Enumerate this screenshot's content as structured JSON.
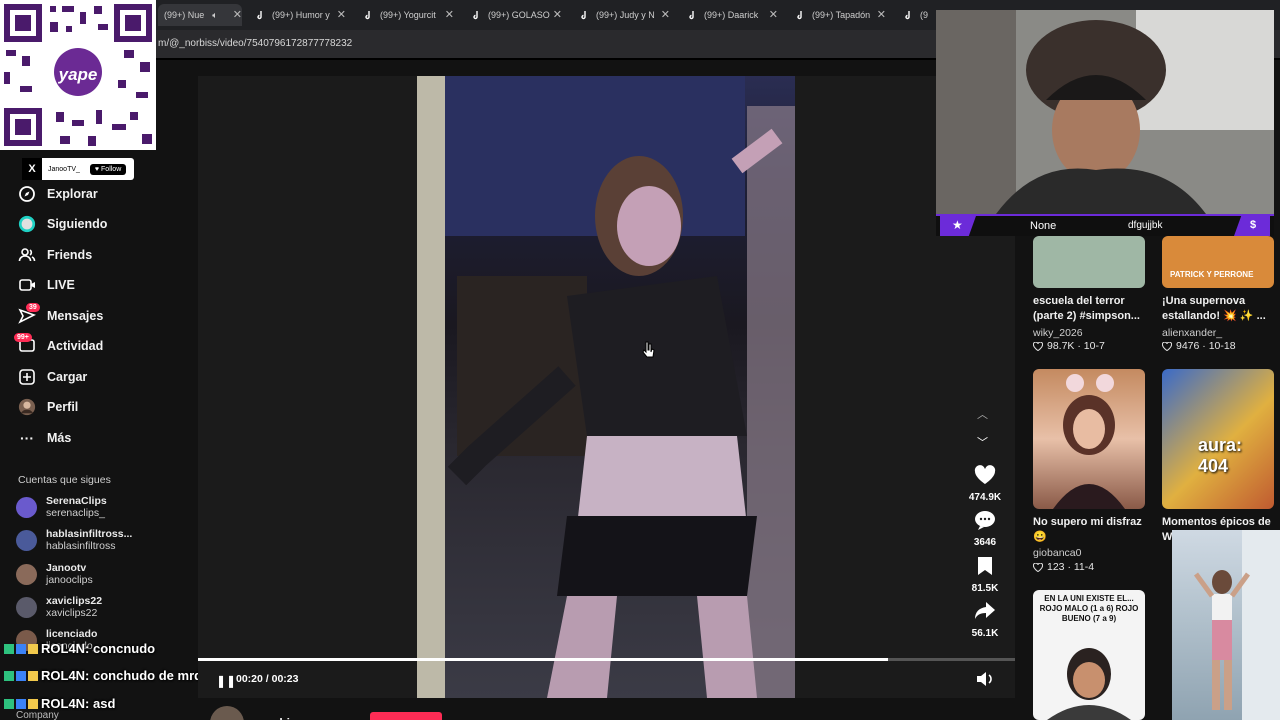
{
  "browser": {
    "tabs": [
      {
        "label": "(99+) Nue",
        "active": true
      },
      {
        "label": "(99+) Humor y",
        "active": false
      },
      {
        "label": "(99+) Yogurcit",
        "active": false
      },
      {
        "label": "(99+) GOLASO",
        "active": false
      },
      {
        "label": "(99+) Judy y N",
        "active": false
      },
      {
        "label": "(99+) Daarick",
        "active": false
      },
      {
        "label": "(99+) Tapadón",
        "active": false
      },
      {
        "label": "(9",
        "active": false
      }
    ],
    "url": "m/@_norbiss/video/7540796172877778232"
  },
  "qr": {
    "brand": "yape"
  },
  "follow_pill": {
    "name": "JanooTV_",
    "button": "Follow"
  },
  "sidebar": {
    "items": [
      {
        "label": "Explorar",
        "icon": "compass-icon"
      },
      {
        "label": "Siguiendo",
        "icon": "following-icon"
      },
      {
        "label": "Friends",
        "icon": "friends-icon"
      },
      {
        "label": "LIVE",
        "icon": "live-icon"
      },
      {
        "label": "Mensajes",
        "icon": "messages-icon",
        "badge": "39"
      },
      {
        "label": "Actividad",
        "icon": "activity-icon",
        "badge": "99+"
      },
      {
        "label": "Cargar",
        "icon": "upload-icon"
      },
      {
        "label": "Perfil",
        "icon": "profile-icon"
      },
      {
        "label": "Más",
        "icon": "more-icon"
      }
    ],
    "following_title": "Cuentas que sigues",
    "accounts": [
      {
        "name": "SerenaClips",
        "handle": "serenaclips_"
      },
      {
        "name": "hablasinfiltross...",
        "handle": "hablasinfiltross"
      },
      {
        "name": "Janootv",
        "handle": "janooclips"
      },
      {
        "name": "xaviclips22",
        "handle": "xaviclips22"
      },
      {
        "name": "licenciado",
        "handle": "licenciado_..."
      }
    ],
    "company": "Company"
  },
  "chat": [
    {
      "user": "ROL4N:",
      "msg": "concnudo"
    },
    {
      "user": "ROL4N:",
      "msg": "conchudo de mrd"
    },
    {
      "user": "ROL4N:",
      "msg": "asd"
    }
  ],
  "player": {
    "time": "00:20 / 00:23",
    "progress": 0.845,
    "author": "norbiss",
    "actions": [
      {
        "icon": "heart-icon",
        "count": "474.9K"
      },
      {
        "icon": "comment-icon",
        "count": "3646"
      },
      {
        "icon": "bookmark-icon",
        "count": "81.5K"
      },
      {
        "icon": "share-icon",
        "count": "56.1K"
      }
    ]
  },
  "webcam": {
    "label_left": "None",
    "label_right": "dfgujjbk"
  },
  "recommendations": [
    {
      "title": "escuela del terror (parte 2) #simpson...",
      "user": "wiky_2026",
      "likes": "98.7K",
      "date": "10-7",
      "thumb_text": ""
    },
    {
      "title": "¡Una supernova estallando! 💥 ✨ ...",
      "user": "alienxander_",
      "likes": "9476",
      "date": "10-18",
      "thumb_text": "PATRICK Y PERRONE"
    },
    {
      "title": "No supero mi disfraz 😀",
      "user": "giobanca0",
      "likes": "123",
      "date": "11-4",
      "thumb_text": ""
    },
    {
      "title": "Momentos épicos de W",
      "user": "",
      "likes": "",
      "date": "",
      "thumb_text": "aura: 404"
    },
    {
      "title": "",
      "user": "",
      "likes": "",
      "date": "",
      "thumb_text": "EN LA UNI EXISTE EL... ROJO MALO (1 a 6) ROJO BUENO (7 a 9)"
    }
  ],
  "colors": {
    "accent": "#fe2c55",
    "stream_purple": "#6c2bd9",
    "background": "#121212"
  }
}
